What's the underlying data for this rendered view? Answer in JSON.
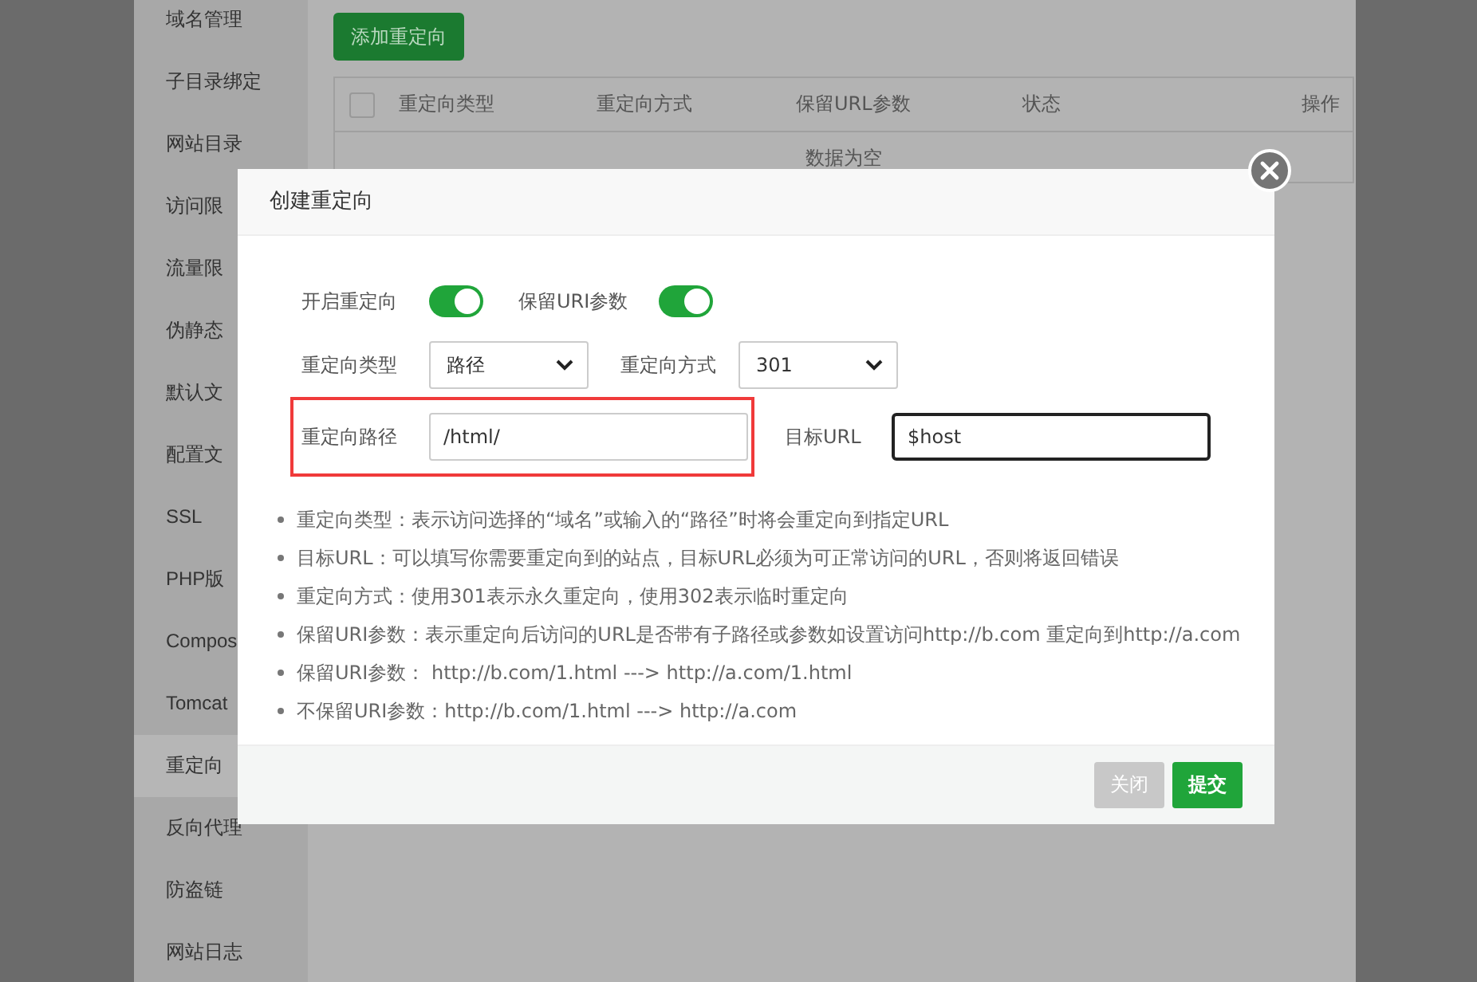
{
  "sidebar": {
    "items": [
      {
        "label": "域名管理",
        "selected": false
      },
      {
        "label": "子目录绑定",
        "selected": false
      },
      {
        "label": "网站目录",
        "selected": false
      },
      {
        "label": "访问限",
        "selected": false
      },
      {
        "label": "流量限",
        "selected": false
      },
      {
        "label": "伪静态",
        "selected": false
      },
      {
        "label": "默认文",
        "selected": false
      },
      {
        "label": "配置文",
        "selected": false
      },
      {
        "label": "SSL",
        "selected": false
      },
      {
        "label": "PHP版",
        "selected": false
      },
      {
        "label": "Compos",
        "selected": false
      },
      {
        "label": "Tomcat",
        "selected": false
      },
      {
        "label": "重定向",
        "selected": true
      },
      {
        "label": "反向代理",
        "selected": false
      },
      {
        "label": "防盗链",
        "selected": false
      },
      {
        "label": "网站日志",
        "selected": false
      }
    ]
  },
  "add_button": "添加重定向",
  "table": {
    "columns": [
      "重定向类型",
      "重定向方式",
      "保留URL参数",
      "状态",
      "操作"
    ],
    "select_all_checked": false,
    "empty_text": "数据为空"
  },
  "dialog": {
    "title": "创建重定向",
    "toggles": [
      {
        "label": "开启重定向",
        "on": true
      },
      {
        "label": "保留URI参数",
        "on": true
      }
    ],
    "selects": [
      {
        "label": "重定向类型",
        "value": "路径"
      },
      {
        "label": "重定向方式",
        "value": "301"
      }
    ],
    "path_field": {
      "label": "重定向路径",
      "value": "/html/",
      "highlighted": true
    },
    "target_field": {
      "label": "目标URL",
      "value": "$host",
      "focused": true
    },
    "notes": [
      "重定向类型：表示访问选择的“域名”或输入的“路径”时将会重定向到指定URL",
      "目标URL：可以填写你需要重定向到的站点，目标URL必须为可正常访问的URL，否则将返回错误",
      "重定向方式：使用301表示永久重定向，使用302表示临时重定向",
      "保留URI参数：表示重定向后访问的URL是否带有子路径或参数如设置访问http://b.com 重定向到http://a.com",
      "保留URI参数： http://b.com/1.html ---> http://a.com/1.html",
      "不保留URI参数：http://b.com/1.html ---> http://a.com"
    ],
    "buttons": [
      {
        "label": "关闭",
        "kind": "secondary"
      },
      {
        "label": "提交",
        "kind": "primary"
      }
    ]
  }
}
